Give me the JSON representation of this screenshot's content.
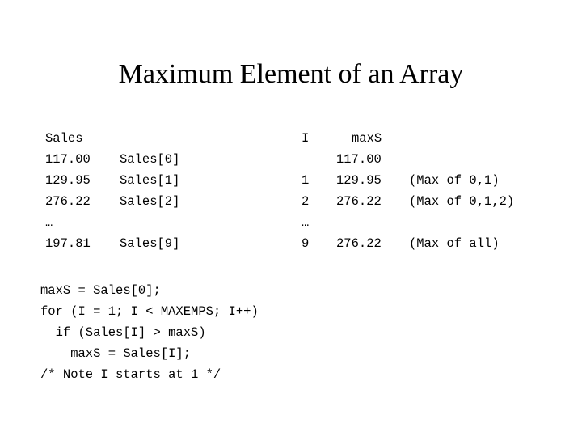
{
  "slide": {
    "title": "Maximum Element of an Array"
  },
  "sales_table": {
    "header": "Sales",
    "ellipsis": "…",
    "rows": [
      {
        "value": "117.00",
        "label": "Sales[0]"
      },
      {
        "value": "129.95",
        "label": "Sales[1]"
      },
      {
        "value": "276.22",
        "label": "Sales[2]"
      }
    ],
    "last_row": {
      "value": "197.81",
      "label": "Sales[9]"
    }
  },
  "trace_table": {
    "header_i": "I",
    "header_maxs": "maxS",
    "ellipsis": "…",
    "rows": [
      {
        "i": "",
        "maxs": "117.00",
        "note": ""
      },
      {
        "i": "1",
        "maxs": "129.95",
        "note": "(Max of 0,1)"
      },
      {
        "i": "2",
        "maxs": "276.22",
        "note": "(Max of 0,1,2)"
      }
    ],
    "last_row": {
      "i": "9",
      "maxs": "276.22",
      "note": "(Max of all)"
    }
  },
  "code": {
    "lines": [
      "maxS = Sales[0];",
      "for (I = 1; I < MAXEMPS; I++)",
      "  if (Sales[I] > maxS)",
      "    maxS = Sales[I];",
      "/* Note I starts at 1 */"
    ]
  },
  "colors": {
    "background": "#ffffff",
    "text": "#000000"
  }
}
